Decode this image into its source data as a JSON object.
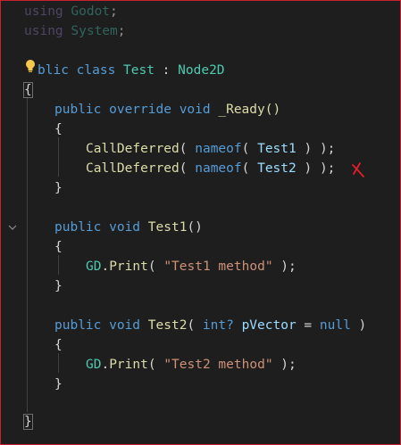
{
  "editor": {
    "lines": {
      "l1": {
        "k": "using",
        "ns": "Godot",
        "end": ";"
      },
      "l2": {
        "k": "using",
        "ns": "System",
        "end": ";"
      },
      "l4": {
        "a": "blic",
        "b": " class ",
        "c": "Test",
        "d": " : ",
        "e": "Node2D"
      },
      "l5": {
        "a": "{"
      },
      "l6": {
        "a": "public",
        "b": " override ",
        "c": "void",
        "d": " _Ready()"
      },
      "l7": {
        "a": "{"
      },
      "l8": {
        "m": "CallDeferred",
        "a": "( ",
        "k": "nameof",
        "b": "( ",
        "v": "Test1",
        "c": " ) );"
      },
      "l9": {
        "m": "CallDeferred",
        "a": "( ",
        "k": "nameof",
        "b": "( ",
        "v": "Test2",
        "c": " ) );"
      },
      "l10": {
        "a": "}"
      },
      "l12": {
        "a": "public",
        "b": " void ",
        "c": "Test1",
        "d": "()"
      },
      "l13": {
        "a": "{"
      },
      "l14": {
        "a": "GD",
        "b": ".",
        "m": "Print",
        "c": "( ",
        "s": "\"Test1 method\"",
        "d": " );"
      },
      "l15": {
        "a": "}"
      },
      "l17": {
        "a": "public",
        "b": " void ",
        "c": "Test2",
        "d": "( ",
        "e": "int?",
        "f": " ",
        "g": "pVector",
        "h": " = ",
        "i": "null",
        "j": " )"
      },
      "l18": {
        "a": "{"
      },
      "l19": {
        "a": "GD",
        "b": ".",
        "m": "Print",
        "c": "( ",
        "s": "\"Test2 method\"",
        "d": " );"
      },
      "l20": {
        "a": "}"
      },
      "l22": {
        "a": "}"
      }
    },
    "annotation_mark": "✗"
  },
  "colors": {
    "background": "#1e1e1e",
    "keyword": "#569cd6",
    "type": "#4ec9b0",
    "method": "#dcdcaa",
    "variable": "#9cdcfe",
    "string": "#ce9178",
    "annotation": "#e0202a"
  },
  "icons": [
    "lightbulb-icon",
    "chevron-down-icon",
    "x-mark-icon"
  ]
}
